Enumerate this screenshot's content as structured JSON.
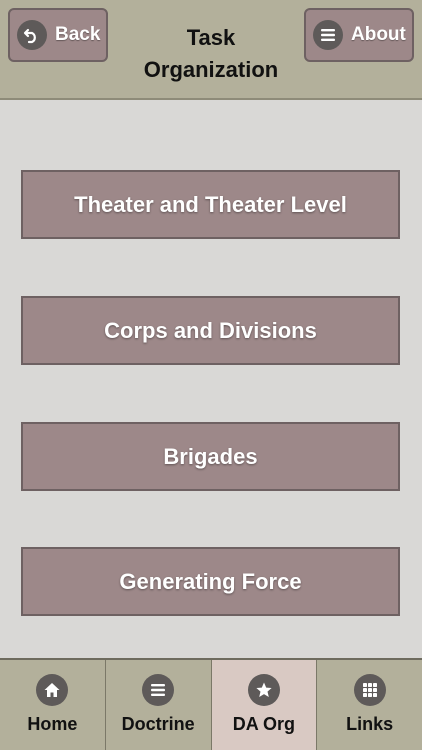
{
  "header": {
    "title_line1": "Task",
    "title_line2": "Organization",
    "back_label": "Back",
    "about_label": "About"
  },
  "menu": [
    {
      "label": "Theater and Theater Level"
    },
    {
      "label": "Corps and Divisions"
    },
    {
      "label": "Brigades"
    },
    {
      "label": "Generating Force"
    }
  ],
  "tabs": [
    {
      "label": "Home",
      "icon": "home-icon"
    },
    {
      "label": "Doctrine",
      "icon": "list-icon"
    },
    {
      "label": "DA Org",
      "icon": "star-icon",
      "active": true
    },
    {
      "label": "Links",
      "icon": "grid-icon"
    }
  ],
  "colors": {
    "header_bg": "#b3b09b",
    "button_bg": "#9d8889",
    "page_bg": "#d9d8d6",
    "active_tab_bg": "#d9c9c3"
  }
}
